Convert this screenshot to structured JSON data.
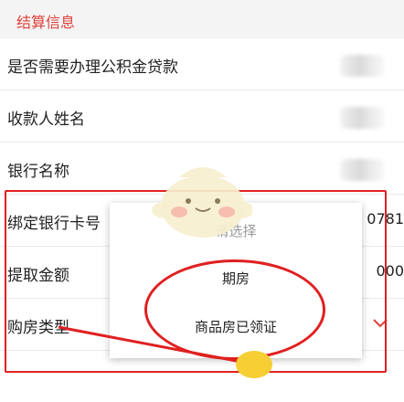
{
  "section": {
    "title": "结算信息"
  },
  "rows": [
    {
      "label": "是否需要办理公积金贷款",
      "value": ""
    },
    {
      "label": "收款人姓名",
      "value": ""
    },
    {
      "label": "银行名称",
      "value": ""
    },
    {
      "label": "绑定银行卡号",
      "value": "0781"
    },
    {
      "label": "提取金额",
      "value": "000"
    },
    {
      "label": "购房类型",
      "value": ""
    }
  ],
  "dropdown": {
    "placeholder": "请选择",
    "options": [
      "期房",
      "商品房已领证"
    ]
  },
  "colors": {
    "accent": "#e0413a",
    "annotation": "#e02020",
    "placeholder": "#999999"
  },
  "icons": {
    "type_chevron": "chevron-down-icon",
    "mascot": "mascot-sticker-icon"
  }
}
